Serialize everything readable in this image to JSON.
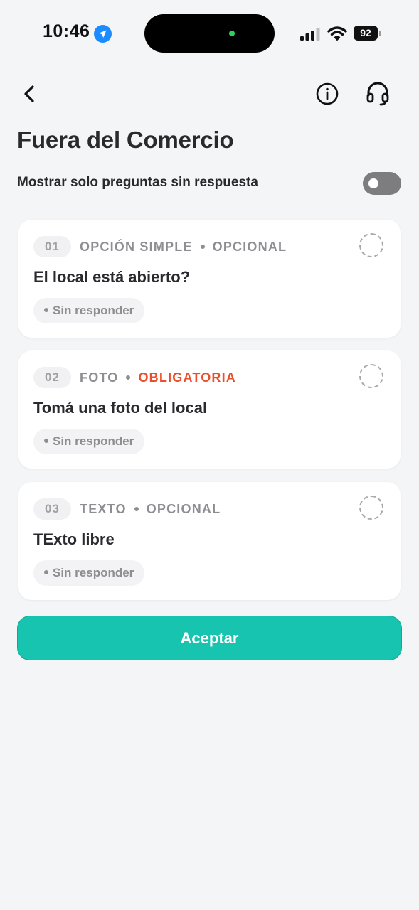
{
  "status_bar": {
    "time": "10:46",
    "location_icon": "location-arrow-icon",
    "signal_icon": "cellular-signal-icon",
    "wifi_icon": "wifi-icon",
    "battery_level": "92"
  },
  "nav": {
    "back_icon": "chevron-left-icon",
    "info_icon": "info-icon",
    "support_icon": "headset-icon"
  },
  "page": {
    "title": "Fuera del Comercio",
    "filter_label": "Mostrar solo preguntas sin respuesta",
    "filter_enabled": false
  },
  "questions": [
    {
      "number": "01",
      "type": "OPCIÓN SIMPLE",
      "requirement": "OPCIONAL",
      "text": "El local está abierto?",
      "status": "Sin responder"
    },
    {
      "number": "02",
      "type": "FOTO",
      "requirement": "OBLIGATORIA",
      "text": "Tomá una foto del local",
      "status": "Sin responder"
    },
    {
      "number": "03",
      "type": "TEXTO",
      "requirement": "OPCIONAL",
      "text": "TExto libre",
      "status": "Sin responder"
    }
  ],
  "actions": {
    "accept_label": "Aceptar"
  },
  "colors": {
    "accent": "#17c4b0",
    "required": "#ea4f2c",
    "background": "#f4f5f7",
    "toggle_off": "#7d7d80"
  }
}
